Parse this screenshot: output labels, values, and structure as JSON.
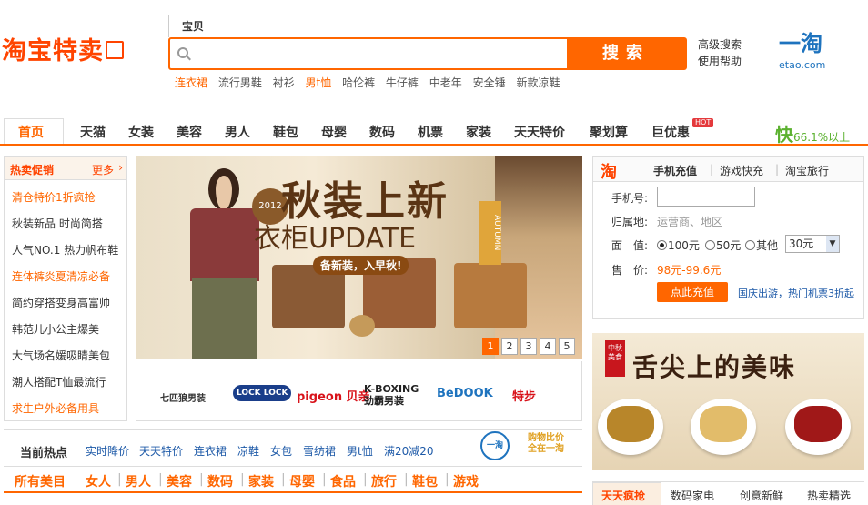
{
  "header": {
    "logo": "淘宝特卖",
    "search_tab": "宝贝",
    "search_placeholder": "",
    "search_button": "搜索",
    "hot_words": [
      "连衣裙",
      "流行男鞋",
      "衬衫",
      "男t恤",
      "哈伦裤",
      "牛仔裤",
      "中老年",
      "安全锤",
      "新款凉鞋"
    ],
    "advanced_search": "高级搜索",
    "help": "使用帮助",
    "etao_logo": "一淘",
    "etao_url": "etao.com"
  },
  "nav": {
    "items": [
      "首页",
      "天猫",
      "女装",
      "美容",
      "男人",
      "鞋包",
      "母婴",
      "数码",
      "机票",
      "家装",
      "天天特价",
      "聚划算",
      "巨优惠"
    ],
    "hot_badge": "HOT",
    "kuai": "快",
    "kuai_text": "66.1%以上"
  },
  "left_panel": {
    "title": "热卖促销",
    "more": "更多",
    "items": [
      "清仓特价1折疯抢",
      "秋装新品 时尚简搭",
      "人气NO.1 热力帆布鞋",
      "连体裤炎夏清凉必备",
      "简约穿搭变身高富帅",
      "韩范儿小公主爆美",
      "大气场名媛吸睛美包",
      "潮人搭配T恤最流行",
      "求生户外必备用具"
    ]
  },
  "banner": {
    "year": "2012",
    "title": "秋装上新",
    "subtitle": "衣柜UPDATE",
    "autumn": "AUTUMN",
    "tag": "备新装，入早秋!",
    "pages": [
      "1",
      "2",
      "3",
      "4",
      "5"
    ],
    "active_page": 1
  },
  "brands": [
    "七匹狼男装",
    "LOCK LOCK",
    "pigeon 贝亲",
    "K-BOXING 劲霸男装",
    "BeDOOK",
    "特步"
  ],
  "hot_row": {
    "label": "当前热点",
    "keywords": [
      "实时降价",
      "天天特价",
      "连衣裙",
      "凉鞋",
      "女包",
      "雪纺裙",
      "男t恤",
      "满20减20"
    ],
    "badge_circle": "一淘",
    "badge_text1": "购物比价",
    "badge_text2": "全在一淘"
  },
  "categories": [
    "所有美目",
    "女人",
    "男人",
    "美容",
    "数码",
    "家装",
    "母婴",
    "食品",
    "旅行",
    "鞋包",
    "游戏"
  ],
  "recharge": {
    "logo": "淘",
    "tabs": [
      "手机充值",
      "游戏快充",
      "淘宝旅行"
    ],
    "phone_label": "手机号:",
    "area_label": "归属地:",
    "area_value": "运营商、地区",
    "amount_label": "面　值:",
    "options": [
      "100元",
      "50元",
      "其他"
    ],
    "select_value": "30元",
    "price_label": "售　价:",
    "price_value": "98元-99.6元",
    "button": "点此充值",
    "promo": "国庆出游，热门机票3折起"
  },
  "food_banner": {
    "seal": "中秋美食",
    "title": "舌尖上的美味"
  },
  "bottom_tabs": [
    "天天疯抢",
    "数码家电",
    "创意新鲜",
    "热卖精选"
  ]
}
